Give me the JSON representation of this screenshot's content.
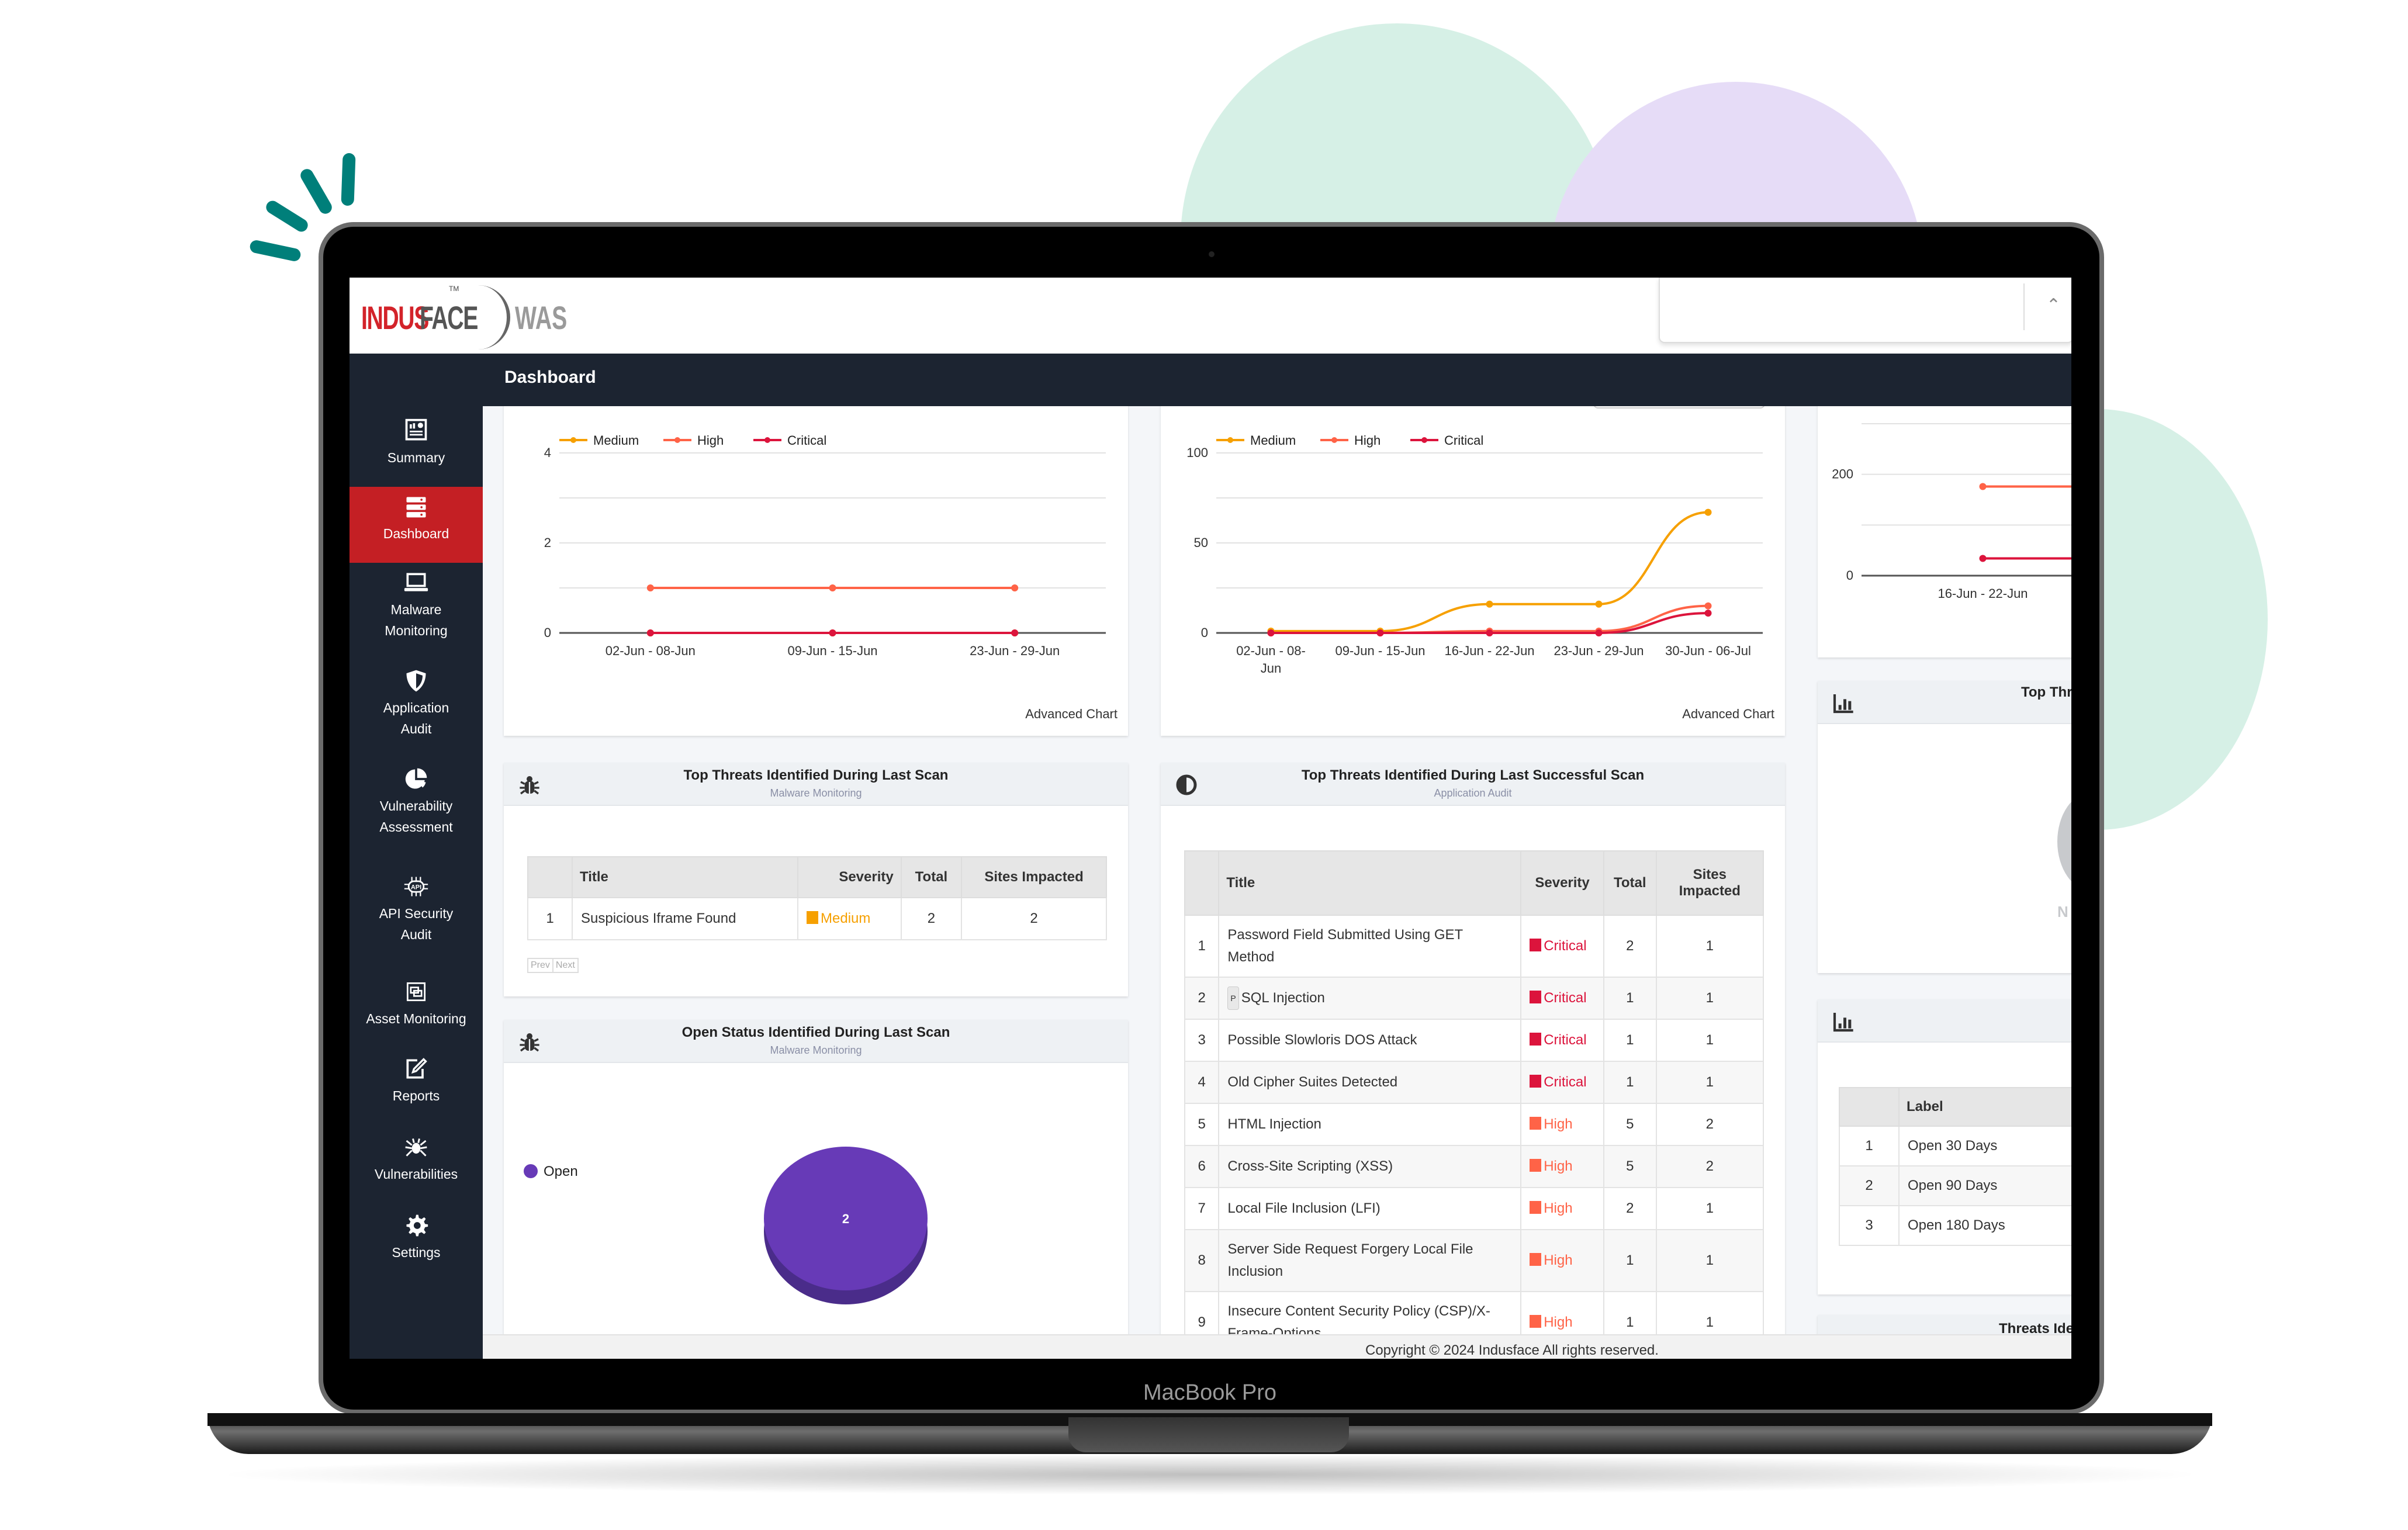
{
  "device_label": "MacBook Pro",
  "app": {
    "brand": {
      "name_part1": "INDUS",
      "name_part2": "FACE",
      "tm": "TM",
      "product": "WAS"
    },
    "page_title": "Dashboard",
    "user_select": {
      "value": "",
      "chevron": "chevron-up-icon"
    },
    "colors": {
      "navbar": "#1c2431",
      "active_nav": "#c41f24",
      "medium": "#f6a000",
      "high": "#ff6347",
      "critical": "#dc143c",
      "pie": "#673ab7"
    }
  },
  "sidebar": {
    "items": [
      {
        "label": "Summary",
        "icon": "summary-icon",
        "active": false
      },
      {
        "label": "Dashboard",
        "icon": "server-icon",
        "active": true
      },
      {
        "label": "Malware Monitoring",
        "icon": "laptop-icon",
        "active": false
      },
      {
        "label": "Application Audit",
        "icon": "shield-icon",
        "active": false
      },
      {
        "label": "Vulnerability Assessment",
        "icon": "pie-chart-icon",
        "active": false
      },
      {
        "label": "API Security Audit",
        "icon": "api-icon",
        "active": false
      },
      {
        "label": "Asset Monitoring",
        "icon": "asset-icon",
        "active": false
      },
      {
        "label": "Reports",
        "icon": "edit-icon",
        "active": false
      },
      {
        "label": "Vulnerabilities",
        "icon": "spider-icon",
        "active": false
      },
      {
        "label": "Settings",
        "icon": "gear-icon",
        "active": false
      }
    ]
  },
  "chart_data": [
    {
      "type": "line",
      "title": "",
      "categories": [
        "02-Jun - 08-Jun",
        "09-Jun - 15-Jun",
        "23-Jun - 29-Jun"
      ],
      "series": [
        {
          "name": "Medium",
          "values": [
            0,
            0,
            0
          ]
        },
        {
          "name": "High",
          "values": [
            1,
            1,
            1
          ]
        },
        {
          "name": "Critical",
          "values": [
            0,
            0,
            0
          ]
        }
      ],
      "ylim": [
        0,
        4
      ],
      "yticks": [
        0,
        2,
        4
      ],
      "legend": "top-left",
      "grid": true,
      "footer_link": "Advanced Chart"
    },
    {
      "type": "line",
      "title": "",
      "categories": [
        "02-Jun - 08-Jun",
        "09-Jun - 15-Jun",
        "16-Jun - 22-Jun",
        "23-Jun - 29-Jun",
        "30-Jun - 06-Jul"
      ],
      "series": [
        {
          "name": "Medium",
          "values": [
            1,
            1,
            16,
            16,
            67
          ]
        },
        {
          "name": "High",
          "values": [
            0,
            0,
            1,
            1,
            15
          ]
        },
        {
          "name": "Critical",
          "values": [
            0,
            0,
            0,
            0,
            11
          ]
        }
      ],
      "ylim": [
        0,
        100
      ],
      "yticks": [
        0,
        50,
        100
      ],
      "legend": "top-left",
      "grid": true,
      "footer_link": "Advanced Chart"
    },
    {
      "type": "line",
      "title": "",
      "categories": [
        "16-Jun - 22-Jun"
      ],
      "series": [
        {
          "name": "High",
          "values": [
            176
          ]
        },
        {
          "name": "Critical",
          "values": [
            34
          ]
        }
      ],
      "ylim": [
        0,
        300
      ],
      "yticks": [
        0,
        200
      ],
      "grid": true
    },
    {
      "type": "pie",
      "title": "Open Status Identified During Last Scan",
      "subtitle": "Malware Monitoring",
      "categories": [
        "Open"
      ],
      "values": [
        2
      ],
      "legend": "left"
    }
  ],
  "panels": {
    "malware_threats": {
      "title": "Top Threats Identified During Last Scan",
      "subtitle": "Malware Monitoring",
      "columns": [
        "",
        "Title",
        "Severity",
        "Total",
        "Sites Impacted"
      ],
      "rows": [
        {
          "n": "1",
          "title": "Suspicious Iframe Found",
          "severity": "Medium",
          "total": "2",
          "sites": "2"
        }
      ],
      "pager": {
        "prev": "Prev",
        "next": "Next"
      }
    },
    "open_status": {
      "title": "Open Status Identified During Last Scan",
      "subtitle": "Malware Monitoring",
      "legend": "Open",
      "value_label": "2"
    },
    "app_threats": {
      "title": "Top Threats Identified During Last Successful Scan",
      "subtitle": "Application Audit",
      "columns": [
        "",
        "Title",
        "Severity",
        "Total",
        "Sites Impacted"
      ],
      "rows": [
        {
          "n": "1",
          "title": "Password Field Submitted Using GET Method",
          "severity": "Critical",
          "total": "2",
          "sites": "1",
          "badge": ""
        },
        {
          "n": "2",
          "title": "SQL Injection",
          "severity": "Critical",
          "total": "1",
          "sites": "1",
          "badge": "P"
        },
        {
          "n": "3",
          "title": "Possible Slowloris DOS Attack",
          "severity": "Critical",
          "total": "1",
          "sites": "1",
          "badge": ""
        },
        {
          "n": "4",
          "title": "Old Cipher Suites Detected",
          "severity": "Critical",
          "total": "1",
          "sites": "1",
          "badge": ""
        },
        {
          "n": "5",
          "title": "HTML Injection",
          "severity": "High",
          "total": "5",
          "sites": "2",
          "badge": ""
        },
        {
          "n": "6",
          "title": "Cross-Site Scripting (XSS)",
          "severity": "High",
          "total": "5",
          "sites": "2",
          "badge": ""
        },
        {
          "n": "7",
          "title": "Local File Inclusion (LFI)",
          "severity": "High",
          "total": "2",
          "sites": "1",
          "badge": ""
        },
        {
          "n": "8",
          "title": "Server Side Request Forgery Local File Inclusion",
          "severity": "High",
          "total": "1",
          "sites": "1",
          "badge": ""
        },
        {
          "n": "9",
          "title": "Insecure Content Security Policy (CSP)/X-Frame-Options",
          "severity": "High",
          "total": "1",
          "sites": "1",
          "badge": ""
        }
      ]
    },
    "right_top_threats": {
      "title": "Top Thr",
      "empty_label": "N"
    },
    "right_open_days": {
      "columns": [
        "",
        "Label"
      ],
      "rows": [
        {
          "n": "1",
          "label": "Open 30 Days"
        },
        {
          "n": "2",
          "label": "Open 90 Days"
        },
        {
          "n": "3",
          "label": "Open 180 Days"
        }
      ]
    },
    "right_threats_identified": {
      "title": "Threats Ide"
    }
  },
  "footer": {
    "copyright": "Copyright © 2024 Indusface All rights reserved."
  }
}
